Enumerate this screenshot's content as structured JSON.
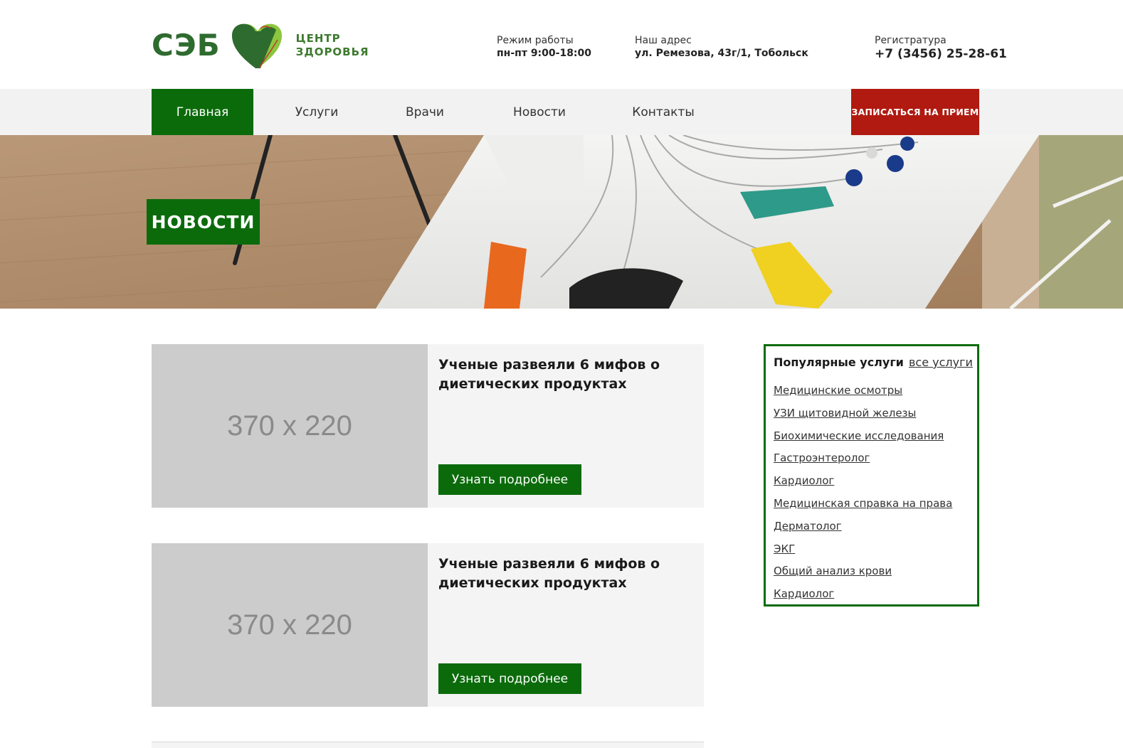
{
  "header": {
    "logo_main": "СЭБ",
    "logo_sub_line1": "ЦЕНТР",
    "logo_sub_line2": "ЗДОРОВЬЯ",
    "hours_label": "Режим работы",
    "hours_value": "пн-пт 9:00-18:00",
    "address_label": "Наш адрес",
    "address_value": "ул. Ремезова, 43г/1, Тобольск",
    "phone_label": "Регистратура",
    "phone_value": "+7 (3456) 25-28-61"
  },
  "nav": {
    "items": [
      {
        "label": "Главная",
        "active": true
      },
      {
        "label": "Услуги",
        "active": false
      },
      {
        "label": "Врачи",
        "active": false
      },
      {
        "label": "Новости",
        "active": false
      },
      {
        "label": "Контакты",
        "active": false
      }
    ],
    "cta_label": "ЗАПИСАТЬСЯ НА ПРИЕМ"
  },
  "banner": {
    "title": "НОВОСТИ"
  },
  "news": [
    {
      "thumb_placeholder": "370 x 220",
      "title": "Ученые развеяли 6 мифов о диетических продуктах",
      "button_label": "Узнать подробнее"
    },
    {
      "thumb_placeholder": "370 x 220",
      "title": "Ученые развеяли 6 мифов о диетических продуктах",
      "button_label": "Узнать подробнее"
    }
  ],
  "sidebar": {
    "title": "Популярные услуги",
    "all_link": "все услуги",
    "items": [
      "Медицинские осмотры",
      "УЗИ щитовидной железы",
      "Биохимические исследования",
      "Гастроэнтеролог",
      "Кардиолог",
      "Медицинская справка на права",
      "Дерматолог",
      "ЭКГ",
      "Общий анализ крови",
      "Кардиолог"
    ]
  },
  "colors": {
    "brand_green": "#0b6b0b",
    "cta_red": "#b01a10",
    "nav_bg": "#f2f2f2",
    "card_bg": "#f4f4f4",
    "placeholder_bg": "#cccccc"
  }
}
